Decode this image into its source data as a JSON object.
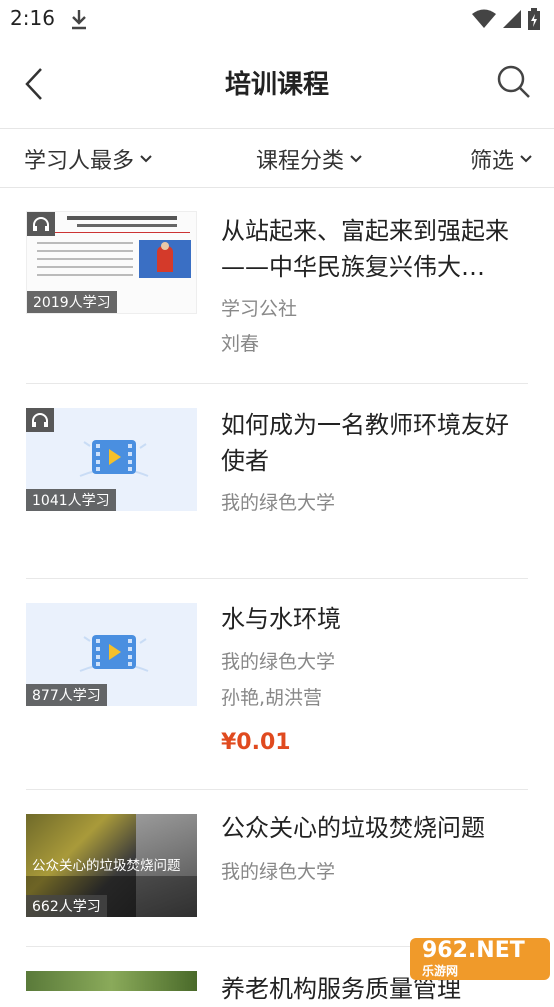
{
  "status": {
    "time": "2:16"
  },
  "header": {
    "title": "培训课程"
  },
  "filters": [
    {
      "label": "学习人最多"
    },
    {
      "label": "课程分类"
    },
    {
      "label": "筛选"
    }
  ],
  "courses": [
    {
      "title": "从站起来、富起来到强起来——中华民族复兴伟大…",
      "publisher": "学习公社",
      "teacher": "刘春",
      "count": "2019人学习",
      "price": ""
    },
    {
      "title": "如何成为一名教师环境友好使者",
      "publisher": "我的绿色大学",
      "teacher": "",
      "count": "1041人学习",
      "price": ""
    },
    {
      "title": "水与水环境",
      "publisher": "我的绿色大学",
      "teacher": "孙艳,胡洪营",
      "count": "877人学习",
      "price": "¥0.01"
    },
    {
      "title": "公众关心的垃圾焚烧问题",
      "publisher": "我的绿色大学",
      "teacher": "",
      "count": "662人学习",
      "thumb_text": "公众关心的垃圾焚烧问题",
      "price": ""
    },
    {
      "title": "养老机构服务质量管理",
      "publisher": "",
      "teacher": "",
      "count": "",
      "price": ""
    }
  ],
  "watermark": {
    "main": "962.NET",
    "sub": "乐游网"
  }
}
